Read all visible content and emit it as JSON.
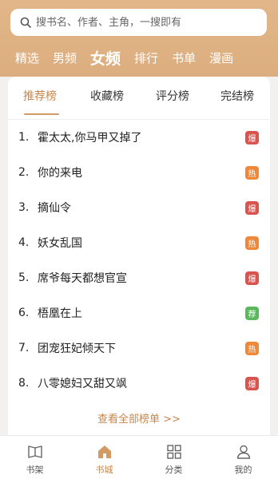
{
  "search": {
    "placeholder": "搜书名、作者、主角，一搜即有"
  },
  "nav": [
    {
      "label": "精选"
    },
    {
      "label": "男频"
    },
    {
      "label": "女频",
      "active": true
    },
    {
      "label": "排行"
    },
    {
      "label": "书单"
    },
    {
      "label": "漫画"
    }
  ],
  "tabs": [
    {
      "label": "推荐榜",
      "active": true
    },
    {
      "label": "收藏榜"
    },
    {
      "label": "评分榜"
    },
    {
      "label": "完结榜"
    }
  ],
  "list": [
    {
      "num": "1.",
      "title": "霍太太,你马甲又掉了",
      "badge": "爆",
      "badge_color": "#d9534f"
    },
    {
      "num": "2.",
      "title": "你的来电",
      "badge": "热",
      "badge_color": "#f0883a"
    },
    {
      "num": "3.",
      "title": "摘仙令",
      "badge": "爆",
      "badge_color": "#d9534f"
    },
    {
      "num": "4.",
      "title": "妖女乱国",
      "badge": "热",
      "badge_color": "#f0883a"
    },
    {
      "num": "5.",
      "title": "席爷每天都想官宣",
      "badge": "爆",
      "badge_color": "#d9534f"
    },
    {
      "num": "6.",
      "title": "梧凰在上",
      "badge": "荐",
      "badge_color": "#5cb85c"
    },
    {
      "num": "7.",
      "title": "团宠狂妃倾天下",
      "badge": "热",
      "badge_color": "#f0883a"
    },
    {
      "num": "8.",
      "title": "八零媳妇又甜又飒",
      "badge": "爆",
      "badge_color": "#d9534f"
    }
  ],
  "more_label": "查看全部榜单 >>",
  "bottom_nav": [
    {
      "label": "书架",
      "icon": "bookshelf-icon"
    },
    {
      "label": "书城",
      "icon": "bookstore-icon",
      "active": true
    },
    {
      "label": "分类",
      "icon": "category-icon"
    },
    {
      "label": "我的",
      "icon": "profile-icon"
    }
  ],
  "colors": {
    "accent": "#c8864d",
    "header": "#dcae7f"
  }
}
